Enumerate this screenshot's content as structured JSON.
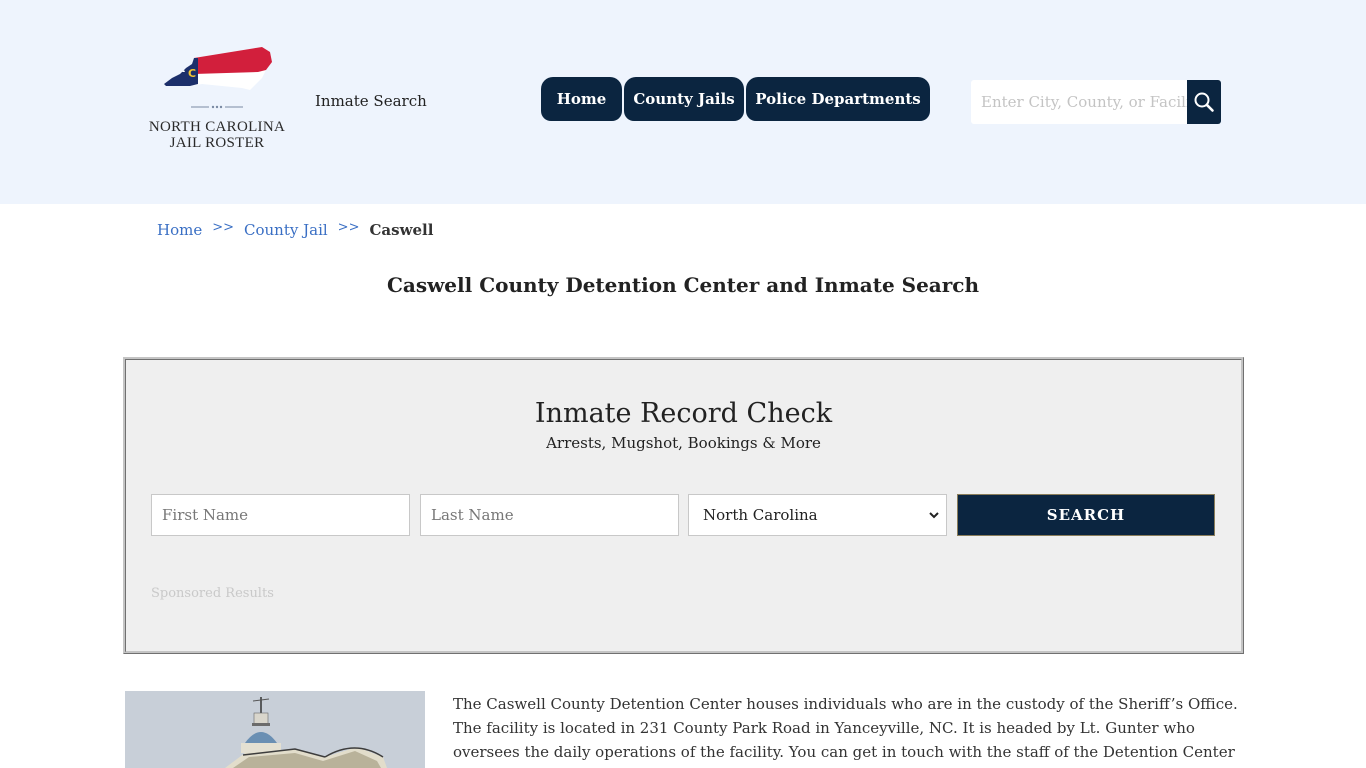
{
  "header": {
    "logo": {
      "line1": "NORTH CAROLINA",
      "line2": "JAIL ROSTER",
      "flag_colors": {
        "red": "#d21f3c",
        "blue": "#1c2f6b",
        "white": "#ffffff",
        "gold": "#f3c431"
      },
      "badge_letter": "C"
    },
    "site_link": "Inmate Search",
    "nav": [
      {
        "label": "Home"
      },
      {
        "label": "County Jails"
      },
      {
        "label": "Police Departments"
      }
    ],
    "search": {
      "placeholder": "Enter City, County, or Facility",
      "icon": "search-icon"
    }
  },
  "breadcrumb": {
    "items": [
      {
        "label": "Home"
      },
      {
        "label": "County Jail"
      },
      {
        "label": "Caswell"
      }
    ],
    "separator": ">>"
  },
  "page_title": "Caswell County Detention Center and Inmate Search",
  "record_check": {
    "title": "Inmate Record Check",
    "subtitle": "Arrests, Mugshot, Bookings & More",
    "first_name_placeholder": "First Name",
    "last_name_placeholder": "Last Name",
    "state_selected": "North Carolina",
    "search_label": "SEARCH",
    "sponsored": "Sponsored Results"
  },
  "content": {
    "image_alt": "Caswell County courthouse dome",
    "paragraph": "The Caswell County Detention Center houses individuals who are in the custody of the Sheriff’s Office. The facility is located in 231 County Park Road in Yanceyville, NC. It is headed by Lt. Gunter who oversees the daily operations of the facility. You can get in touch with the staff of the Detention Center"
  },
  "colors": {
    "header_bg": "#eef4fd",
    "navy": "#0b2540",
    "link": "#3a6fc4",
    "panel_bg": "#efefef"
  }
}
